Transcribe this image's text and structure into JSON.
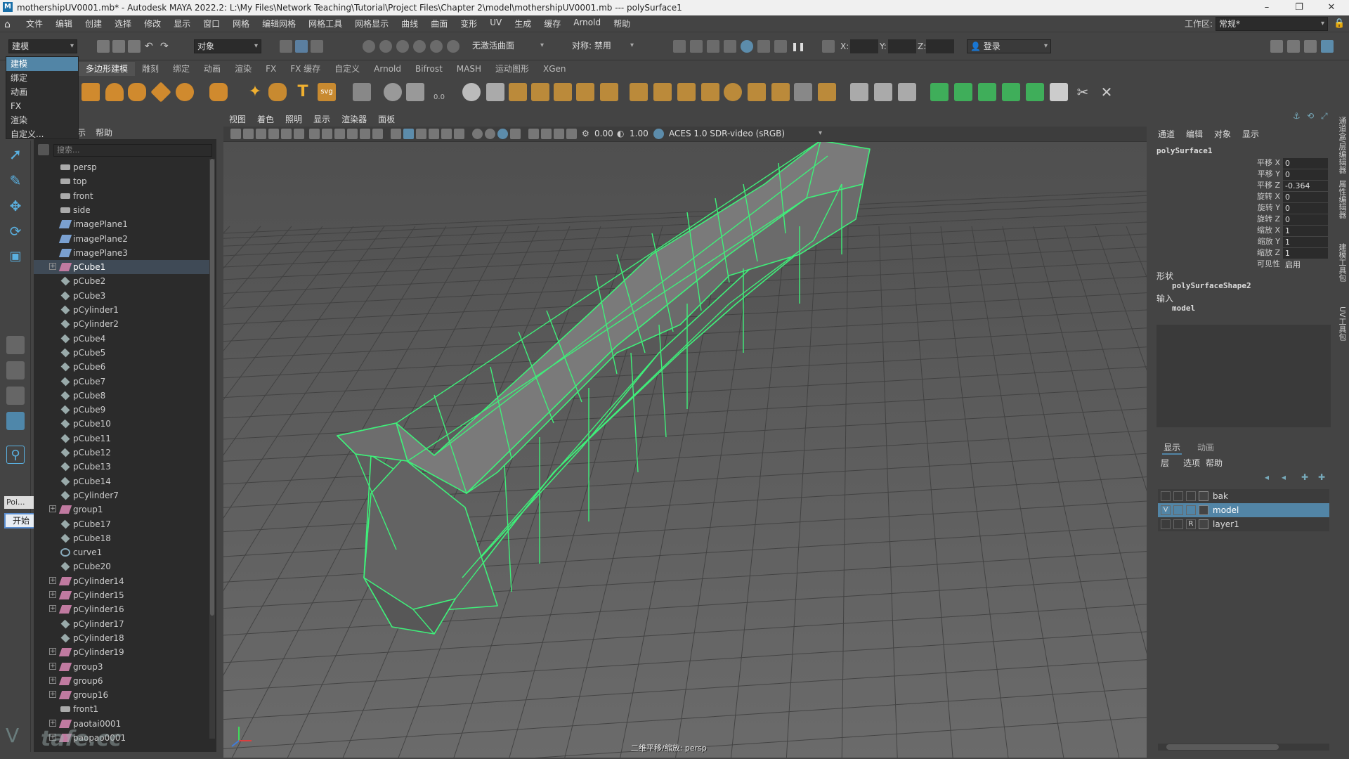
{
  "window": {
    "title": "mothershipUV0001.mb* - Autodesk MAYA 2022.2: L:\\My Files\\Network Teaching\\Tutorial\\Project Files\\Chapter 2\\model\\mothershipUV0001.mb  ---  polySurface1",
    "minimize": "–",
    "maximize": "❐",
    "close": "✕"
  },
  "menubar": [
    "文件",
    "编辑",
    "创建",
    "选择",
    "修改",
    "显示",
    "窗口",
    "网格",
    "编辑网格",
    "网格工具",
    "网格显示",
    "曲线",
    "曲面",
    "变形",
    "UV",
    "生成",
    "缓存",
    "Arnold",
    "帮助"
  ],
  "workspace": {
    "label": "工作区:",
    "value": "常规*"
  },
  "statusline": {
    "mode_menu": "建模",
    "selection_mode": "对象",
    "live_surface": "无激活曲面",
    "symmetry": "对称: 禁用",
    "x_label": "X:",
    "y_label": "Y:",
    "z_label": "Z:",
    "login": "登录"
  },
  "mode_menu_items": [
    "建模",
    "绑定",
    "动画",
    "FX",
    "渲染",
    "自定义..."
  ],
  "shelf_tabs": [
    "多边形建模",
    "雕刻",
    "绑定",
    "动画",
    "渲染",
    "FX",
    "FX 缓存",
    "自定义",
    "Arnold",
    "Bifrost",
    "MASH",
    "运动图形",
    "XGen"
  ],
  "outliner": {
    "menu": [
      "示",
      "帮助"
    ],
    "search_placeholder": "搜索...",
    "items": [
      {
        "name": "persp",
        "type": "camera",
        "expand": false
      },
      {
        "name": "top",
        "type": "camera",
        "expand": false
      },
      {
        "name": "front",
        "type": "camera",
        "expand": false
      },
      {
        "name": "side",
        "type": "camera",
        "expand": false
      },
      {
        "name": "imagePlane1",
        "type": "image",
        "expand": false
      },
      {
        "name": "imagePlane2",
        "type": "image",
        "expand": false
      },
      {
        "name": "imagePlane3",
        "type": "image",
        "expand": false
      },
      {
        "name": "pCube1",
        "type": "group",
        "expand": true,
        "selected": true
      },
      {
        "name": "pCube2",
        "type": "mesh",
        "expand": false
      },
      {
        "name": "pCube3",
        "type": "mesh",
        "expand": false
      },
      {
        "name": "pCylinder1",
        "type": "mesh",
        "expand": false
      },
      {
        "name": "pCylinder2",
        "type": "mesh",
        "expand": false
      },
      {
        "name": "pCube4",
        "type": "mesh",
        "expand": false
      },
      {
        "name": "pCube5",
        "type": "mesh",
        "expand": false
      },
      {
        "name": "pCube6",
        "type": "mesh",
        "expand": false
      },
      {
        "name": "pCube7",
        "type": "mesh",
        "expand": false
      },
      {
        "name": "pCube8",
        "type": "mesh",
        "expand": false
      },
      {
        "name": "pCube9",
        "type": "mesh",
        "expand": false
      },
      {
        "name": "pCube10",
        "type": "mesh",
        "expand": false
      },
      {
        "name": "pCube11",
        "type": "mesh",
        "expand": false
      },
      {
        "name": "pCube12",
        "type": "mesh",
        "expand": false
      },
      {
        "name": "pCube13",
        "type": "mesh",
        "expand": false
      },
      {
        "name": "pCube14",
        "type": "mesh",
        "expand": false
      },
      {
        "name": "pCylinder7",
        "type": "mesh",
        "expand": false
      },
      {
        "name": "group1",
        "type": "group",
        "expand": true
      },
      {
        "name": "pCube17",
        "type": "mesh",
        "expand": false
      },
      {
        "name": "pCube18",
        "type": "mesh",
        "expand": false
      },
      {
        "name": "curve1",
        "type": "curve",
        "expand": false
      },
      {
        "name": "pCube20",
        "type": "mesh",
        "expand": false
      },
      {
        "name": "pCylinder14",
        "type": "group",
        "expand": true
      },
      {
        "name": "pCylinder15",
        "type": "group",
        "expand": true
      },
      {
        "name": "pCylinder16",
        "type": "group",
        "expand": true
      },
      {
        "name": "pCylinder17",
        "type": "mesh",
        "expand": false
      },
      {
        "name": "pCylinder18",
        "type": "mesh",
        "expand": false
      },
      {
        "name": "pCylinder19",
        "type": "group",
        "expand": true
      },
      {
        "name": "group3",
        "type": "group",
        "expand": true
      },
      {
        "name": "group6",
        "type": "group",
        "expand": true
      },
      {
        "name": "group16",
        "type": "group",
        "expand": true
      },
      {
        "name": "front1",
        "type": "camera",
        "expand": false
      },
      {
        "name": "paotai0001",
        "type": "group",
        "expand": true
      },
      {
        "name": "paopao0001",
        "type": "group",
        "expand": true
      }
    ]
  },
  "toolbox": {
    "poi_label": "Poi...",
    "start_button": "开始"
  },
  "viewport": {
    "menu": [
      "视图",
      "着色",
      "照明",
      "显示",
      "渲染器",
      "面板"
    ],
    "exposure": "0.00",
    "gamma": "1.00",
    "colorspace": "ACES 1.0 SDR-video (sRGB)",
    "camera_label": "二维平移/缩放: persp"
  },
  "channel_box": {
    "tabs": [
      "通道",
      "编辑",
      "对象",
      "显示"
    ],
    "object_name": "polySurface1",
    "channels": [
      {
        "label": "平移 X",
        "value": "0"
      },
      {
        "label": "平移 Y",
        "value": "0"
      },
      {
        "label": "平移 Z",
        "value": "-0.364"
      },
      {
        "label": "旋转 X",
        "value": "0"
      },
      {
        "label": "旋转 Y",
        "value": "0"
      },
      {
        "label": "旋转 Z",
        "value": "0"
      },
      {
        "label": "缩放 X",
        "value": "1"
      },
      {
        "label": "缩放 Y",
        "value": "1"
      },
      {
        "label": "缩放 Z",
        "value": "1"
      },
      {
        "label": "可见性",
        "value": "启用"
      }
    ],
    "shapes_header": "形状",
    "shape_name": "polySurfaceShape2",
    "inputs_header": "输入",
    "input_name": "model"
  },
  "layer_editor": {
    "tabs": [
      "显示",
      "动画"
    ],
    "menu": [
      "层",
      "选项",
      "帮助"
    ],
    "layers": [
      {
        "name": "bak",
        "v": "",
        "p": "",
        "selected": false
      },
      {
        "name": "model",
        "v": "V",
        "p": "",
        "selected": true
      },
      {
        "name": "layer1",
        "v": "",
        "p": "R",
        "selected": false
      }
    ]
  },
  "right_strip": [
    "通道盒/层编辑器",
    "属性编辑器",
    "建模工具包",
    "UV工具包"
  ],
  "watermark": "tafe.cc",
  "colors": {
    "wire": "#3ff07a",
    "accent": "#5285a6"
  }
}
